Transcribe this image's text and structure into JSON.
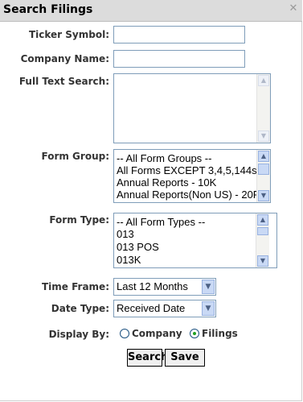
{
  "dialog": {
    "title": "Search Filings"
  },
  "fields": {
    "ticker_label": "Ticker Symbol:",
    "ticker_value": "",
    "company_label": "Company Name:",
    "company_value": "",
    "fulltext_label": "Full Text Search:",
    "fulltext_value": "",
    "form_group_label": "Form Group:",
    "form_group_options": [
      "-- All Form Groups --",
      "All Forms EXCEPT 3,4,5,144s",
      "Annual Reports - 10K",
      "Annual Reports(Non US) - 20F"
    ],
    "form_type_label": "Form Type:",
    "form_type_options": [
      "-- All Form Types --",
      "013",
      "013 POS",
      "013K"
    ],
    "time_frame_label": "Time Frame:",
    "time_frame_value": "Last 12 Months",
    "date_type_label": "Date Type:",
    "date_type_value": "Received Date",
    "display_by_label": "Display By:",
    "display_by_options": [
      {
        "label": "Company",
        "selected": false
      },
      {
        "label": "Filings",
        "selected": true
      }
    ]
  },
  "buttons": {
    "search": "Search",
    "save": "Save"
  },
  "icons": {
    "close": "close-icon",
    "scroll_up": "scroll-up-arrow-icon",
    "scroll_down": "scroll-down-arrow-icon",
    "dropdown": "chevron-down-icon"
  },
  "colors": {
    "titlebar": "#dcdcdc",
    "input_border": "#7f9db9",
    "scroll_accent": "#c9d9f5",
    "radio_selected": "#21a121"
  }
}
